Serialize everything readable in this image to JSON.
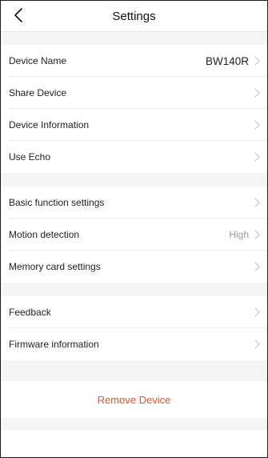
{
  "header": {
    "title": "Settings",
    "back_icon": "chevron-left-icon"
  },
  "sections": {
    "device": [
      {
        "label": "Device Name",
        "value": "BW140R"
      },
      {
        "label": "Share Device"
      },
      {
        "label": "Device Information"
      },
      {
        "label": "Use Echo"
      }
    ],
    "functions": [
      {
        "label": "Basic function settings"
      },
      {
        "label": "Motion detection",
        "value": "High"
      },
      {
        "label": "Memory card settings"
      }
    ],
    "support": [
      {
        "label": "Feedback"
      },
      {
        "label": "Firmware information"
      }
    ]
  },
  "remove_device_label": "Remove Device",
  "colors": {
    "accent": "#e4572e",
    "section_gap": "#f5f5f5"
  },
  "row_chevron_icon": "chevron-right-icon"
}
